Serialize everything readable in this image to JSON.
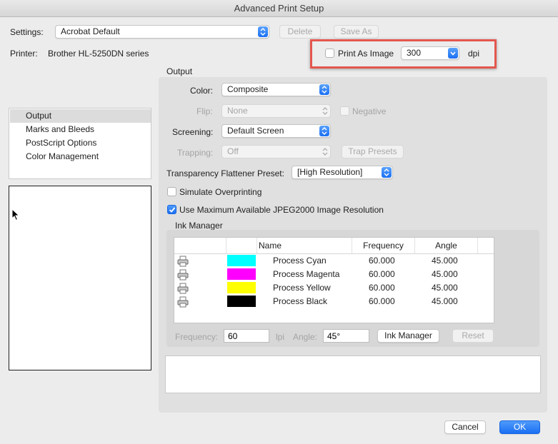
{
  "window": {
    "title": "Advanced Print Setup"
  },
  "settings": {
    "label": "Settings:",
    "value": "Acrobat Default",
    "delete_label": "Delete",
    "save_as_label": "Save As"
  },
  "printer": {
    "label": "Printer:",
    "name": "Brother HL-5250DN series"
  },
  "print_as_image": {
    "label": "Print As Image",
    "checked": false,
    "dpi_value": "300",
    "dpi_unit": "dpi",
    "highlight_color": "#e4574e"
  },
  "sidebar": {
    "items": [
      {
        "label": "Output",
        "selected": true
      },
      {
        "label": "Marks and Bleeds",
        "selected": false
      },
      {
        "label": "PostScript Options",
        "selected": false
      },
      {
        "label": "Color Management",
        "selected": false
      }
    ]
  },
  "output": {
    "section_title": "Output",
    "color_label": "Color:",
    "color_value": "Composite",
    "flip_label": "Flip:",
    "flip_value": "None",
    "negative_label": "Negative",
    "screening_label": "Screening:",
    "screening_value": "Default Screen",
    "trapping_label": "Trapping:",
    "trapping_value": "Off",
    "trap_presets_label": "Trap Presets",
    "flattener_label": "Transparency Flattener Preset:",
    "flattener_value": "[High Resolution]",
    "simulate_overprinting_label": "Simulate Overprinting",
    "simulate_overprinting_checked": false,
    "jpeg2000_label": "Use Maximum Available JPEG2000 Image Resolution",
    "jpeg2000_checked": true
  },
  "ink_manager": {
    "title": "Ink Manager",
    "columns": [
      "",
      "Name",
      "Frequency",
      "Angle"
    ],
    "rows": [
      {
        "icon": "printer-icon",
        "color": "#00ffff",
        "name": "Process Cyan",
        "frequency": "60.000",
        "angle": "45.000"
      },
      {
        "icon": "printer-icon",
        "color": "#ff00ff",
        "name": "Process Magenta",
        "frequency": "60.000",
        "angle": "45.000"
      },
      {
        "icon": "printer-icon",
        "color": "#ffff00",
        "name": "Process Yellow",
        "frequency": "60.000",
        "angle": "45.000"
      },
      {
        "icon": "printer-icon",
        "color": "#000000",
        "name": "Process Black",
        "frequency": "60.000",
        "angle": "45.000"
      }
    ],
    "frequency_label": "Frequency:",
    "frequency_value": "60",
    "lpi_label": "lpi",
    "angle_label": "Angle:",
    "angle_value": "45°",
    "ink_manager_button": "Ink Manager",
    "reset_button": "Reset"
  },
  "footer": {
    "cancel_label": "Cancel",
    "ok_label": "OK"
  },
  "colors": {
    "accent": "#1b6ff3",
    "background": "#ececec"
  }
}
